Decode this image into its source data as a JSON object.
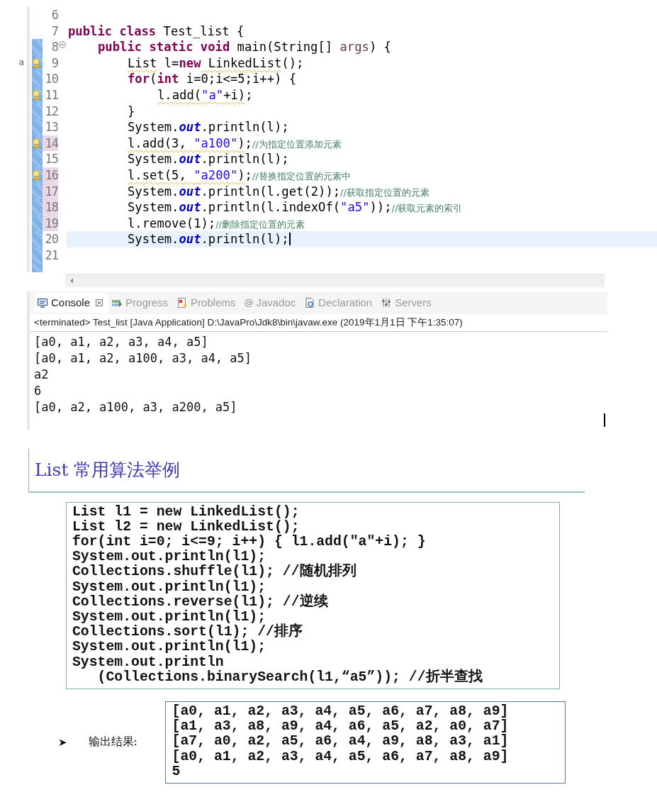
{
  "editor": {
    "margin_mark": "a",
    "lines": [
      {
        "number": "6",
        "range": false,
        "warning": false,
        "changed": false,
        "foldable": false,
        "current": false
      },
      {
        "number": "7",
        "range": false,
        "warning": false,
        "changed": false,
        "foldable": false,
        "current": false,
        "tokens": [
          {
            "kind": "kw",
            "text": "public class"
          },
          {
            "kind": "plain",
            "text": " Test_list {"
          }
        ]
      },
      {
        "number": "8",
        "range": true,
        "warning": false,
        "changed": false,
        "foldable": true,
        "current": false,
        "tokens": [
          {
            "kind": "kw",
            "text": "public static void"
          },
          {
            "kind": "plain",
            "text": " main(String[] "
          },
          {
            "kind": "var",
            "text": "args"
          },
          {
            "kind": "plain",
            "text": ") {"
          }
        ]
      },
      {
        "number": "9",
        "range": true,
        "warning": true,
        "changed": false,
        "foldable": false,
        "current": false,
        "tokens": [
          {
            "kind": "plain",
            "text": "List",
            "underlined": true
          },
          {
            "kind": "plain",
            "text": " l="
          },
          {
            "kind": "kw",
            "text": "new"
          },
          {
            "kind": "plain",
            "text": " LinkedList",
            "underlined": true
          },
          {
            "kind": "plain",
            "text": "();"
          }
        ]
      },
      {
        "number": "10",
        "range": true,
        "warning": false,
        "changed": false,
        "foldable": false,
        "current": false,
        "tokens": [
          {
            "kind": "kw",
            "text": "for"
          },
          {
            "kind": "plain",
            "text": "("
          },
          {
            "kind": "kw",
            "text": "int"
          },
          {
            "kind": "plain",
            "text": " i=0;i<=5;i++) {"
          }
        ]
      },
      {
        "number": "11",
        "range": true,
        "warning": true,
        "changed": false,
        "foldable": false,
        "current": false,
        "tokens": [
          {
            "kind": "plain",
            "text": "l.add(",
            "underlined": true
          },
          {
            "kind": "str",
            "text": "\"a\"",
            "underlined": true
          },
          {
            "kind": "plain",
            "text": "+i)",
            "underlined": true
          },
          {
            "kind": "plain",
            "text": ";"
          }
        ]
      },
      {
        "number": "12",
        "range": true,
        "warning": false,
        "changed": false,
        "foldable": false,
        "current": false,
        "tokens": [
          {
            "kind": "plain",
            "text": "}"
          }
        ]
      },
      {
        "number": "13",
        "range": true,
        "warning": false,
        "changed": false,
        "foldable": false,
        "current": false,
        "tokens": [
          {
            "kind": "plain",
            "text": "System."
          },
          {
            "kind": "field",
            "text": "out"
          },
          {
            "kind": "plain",
            "text": ".println(l);"
          }
        ]
      },
      {
        "number": "14",
        "range": true,
        "warning": true,
        "changed": true,
        "foldable": false,
        "current": false,
        "tokens": [
          {
            "kind": "plain",
            "text": "l.add(3, ",
            "underlined": true
          },
          {
            "kind": "str",
            "text": "\"a100\"",
            "underlined": true
          },
          {
            "kind": "plain",
            "text": ")",
            "underlined": true
          },
          {
            "kind": "plain",
            "text": ";"
          },
          {
            "kind": "cmt",
            "text": "//为指定位置添加元素"
          }
        ]
      },
      {
        "number": "15",
        "range": true,
        "warning": false,
        "changed": false,
        "foldable": false,
        "current": false,
        "tokens": [
          {
            "kind": "plain",
            "text": "System."
          },
          {
            "kind": "field",
            "text": "out"
          },
          {
            "kind": "plain",
            "text": ".println(l);"
          }
        ]
      },
      {
        "number": "16",
        "range": true,
        "warning": true,
        "changed": true,
        "foldable": false,
        "current": false,
        "tokens": [
          {
            "kind": "plain",
            "text": "l.set(5, ",
            "underlined": true
          },
          {
            "kind": "str",
            "text": "\"a200\"",
            "underlined": true
          },
          {
            "kind": "plain",
            "text": ")",
            "underlined": true
          },
          {
            "kind": "plain",
            "text": ";"
          },
          {
            "kind": "cmt",
            "text": "//替换指定位置的元素中"
          }
        ]
      },
      {
        "number": "17",
        "range": true,
        "warning": false,
        "changed": true,
        "foldable": false,
        "current": false,
        "tokens": [
          {
            "kind": "plain",
            "text": "System."
          },
          {
            "kind": "field",
            "text": "out"
          },
          {
            "kind": "plain",
            "text": ".println(l.get(2));"
          },
          {
            "kind": "cmt",
            "text": "//获取指定位置的元素"
          }
        ]
      },
      {
        "number": "18",
        "range": true,
        "warning": false,
        "changed": true,
        "foldable": false,
        "current": false,
        "tokens": [
          {
            "kind": "plain",
            "text": "System."
          },
          {
            "kind": "field",
            "text": "out"
          },
          {
            "kind": "plain",
            "text": ".println(l.indexOf("
          },
          {
            "kind": "str",
            "text": "\"a5\""
          },
          {
            "kind": "plain",
            "text": "));"
          },
          {
            "kind": "cmt",
            "text": "//获取元素的索引"
          }
        ]
      },
      {
        "number": "19",
        "range": true,
        "warning": false,
        "changed": true,
        "foldable": false,
        "current": false,
        "tokens": [
          {
            "kind": "plain",
            "text": "l.remove(1);"
          },
          {
            "kind": "cmt",
            "text": "//删除指定位置的元素"
          }
        ]
      },
      {
        "number": "20",
        "range": true,
        "warning": false,
        "changed": false,
        "foldable": false,
        "current": true,
        "tokens": [
          {
            "kind": "plain",
            "text": "System."
          },
          {
            "kind": "field",
            "text": "out"
          },
          {
            "kind": "plain",
            "text": ".println(l);"
          }
        ]
      },
      {
        "number": "21",
        "range": true,
        "warning": false,
        "changed": false,
        "foldable": false,
        "current": false
      }
    ]
  },
  "console": {
    "tabs": [
      {
        "label": "Console",
        "selected": true,
        "closable": true
      },
      {
        "label": "Progress",
        "selected": false,
        "closable": false
      },
      {
        "label": "Problems",
        "selected": false,
        "closable": false
      },
      {
        "label": "Javadoc",
        "icon_text": "@",
        "selected": false,
        "closable": false
      },
      {
        "label": "Declaration",
        "selected": false,
        "closable": false
      },
      {
        "label": "Servers",
        "selected": false,
        "closable": false
      }
    ],
    "header": "<terminated> Test_list [Java Application] D:\\JavaPro\\Jdk8\\bin\\javaw.exe (2019年1月1日 下午1:35:07)",
    "output": [
      "[a0, a1, a2, a3, a4, a5]",
      "[a0, a1, a2, a100, a3, a4, a5]",
      "a2",
      "6",
      "[a0, a2, a100, a3, a200, a5]"
    ]
  },
  "slide": {
    "title": "List 常用算法举例",
    "code": [
      "List l1 = new LinkedList();",
      "List l2 = new LinkedList();",
      "for(int i=0; i<=9; i++) { l1.add(\"a\"+i); }",
      "System.out.println(l1);",
      "Collections.shuffle(l1); //随机排列",
      "System.out.println(l1);",
      "Collections.reverse(l1); //逆续",
      "System.out.println(l1);",
      "Collections.sort(l1); //排序",
      "System.out.println(l1);",
      "System.out.println",
      "   (Collections.binarySearch(l1,“a5”)); //折半查找"
    ],
    "bullet": "➤",
    "output_label": "输出结果:",
    "output": [
      "[a0, a1, a2, a3, a4, a5, a6, a7, a8, a9]",
      "[a1, a3, a8, a9, a4, a6, a5, a2, a0, a7]",
      "[a7, a0, a2, a5, a6, a4, a9, a8, a3, a1]",
      "[a0, a1, a2, a3, a4, a5, a6, a7, a8, a9]",
      "5"
    ]
  }
}
